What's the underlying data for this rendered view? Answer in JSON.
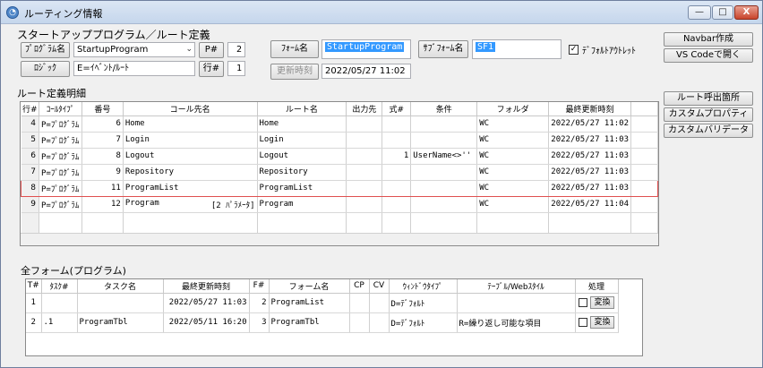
{
  "window": {
    "title": "ルーティング情報",
    "icon": "app-icon",
    "min_label": "—",
    "max_label": "□",
    "close_label": "X"
  },
  "startup": {
    "section_title": "スタートアッププログラム／ルート定義",
    "program_button": "ﾌﾟﾛｸﾞﾗﾑ名",
    "program_value": "StartupProgram",
    "p_label": "P#",
    "p_value": "2",
    "logic_button": "ﾛｼﾞｯｸ",
    "logic_value": "E=ｲﾍﾞﾝﾄ/ﾙｰﾄ",
    "row_label": "行#",
    "row_value": "1",
    "form_button": "ﾌｫｰﾑ名",
    "form_value": "StartupProgram",
    "subform_button": "ｻﾌﾞﾌｫｰﾑ名",
    "subform_value": "SF1",
    "default_outlet_label": "ﾃﾞﾌｫﾙﾄｱｳﾄﾚｯﾄ",
    "default_outlet_checked": "✓",
    "updated_button": "更新時刻",
    "updated_value": "2022/05/27 11:02"
  },
  "right_buttons": {
    "navbar": "Navbar作成",
    "vscode": "VS Codeで開く",
    "route_caller": "ルート呼出箇所",
    "custom_property": "カスタムプロパティ",
    "custom_validator": "カスタムバリデータ"
  },
  "routes": {
    "section_title": "ルート定義明細",
    "columns": [
      "行#",
      "ｺｰﾙﾀｲﾌﾟ",
      "番号",
      "コール先名",
      "ルート名",
      "出力先",
      "式#",
      "条件",
      "フォルダ",
      "最終更新時刻"
    ],
    "rows": [
      {
        "row": "4",
        "type": "P=ﾌﾟﾛｸﾞﾗﾑ",
        "num": "6",
        "callee": "Home",
        "callee_extra": "",
        "route": "Home",
        "output": "",
        "expr": "",
        "cond": "",
        "folder": "WC",
        "updated": "2022/05/27 11:02"
      },
      {
        "row": "5",
        "type": "P=ﾌﾟﾛｸﾞﾗﾑ",
        "num": "7",
        "callee": "Login",
        "callee_extra": "",
        "route": "Login",
        "output": "",
        "expr": "",
        "cond": "",
        "folder": "WC",
        "updated": "2022/05/27 11:03"
      },
      {
        "row": "6",
        "type": "P=ﾌﾟﾛｸﾞﾗﾑ",
        "num": "8",
        "callee": "Logout",
        "callee_extra": "",
        "route": "Logout",
        "output": "",
        "expr": "1",
        "cond": "UserName<>''",
        "folder": "WC",
        "updated": "2022/05/27 11:03"
      },
      {
        "row": "7",
        "type": "P=ﾌﾟﾛｸﾞﾗﾑ",
        "num": "9",
        "callee": "Repository",
        "callee_extra": "",
        "route": "Repository",
        "output": "",
        "expr": "",
        "cond": "",
        "folder": "WC",
        "updated": "2022/05/27 11:03"
      },
      {
        "row": "8",
        "type": "P=ﾌﾟﾛｸﾞﾗﾑ",
        "num": "11",
        "callee": "ProgramList",
        "callee_extra": "",
        "route": "ProgramList",
        "output": "",
        "expr": "",
        "cond": "",
        "folder": "WC",
        "updated": "2022/05/27 11:03"
      },
      {
        "row": "9",
        "type": "P=ﾌﾟﾛｸﾞﾗﾑ",
        "num": "12",
        "callee": "Program",
        "callee_extra": "[2 ﾊﾟﾗﾒｰﾀ]",
        "route": "Program",
        "output": "",
        "expr": "",
        "cond": "",
        "folder": "WC",
        "updated": "2022/05/27 11:04"
      }
    ],
    "selected_row": "8"
  },
  "forms": {
    "section_title": "全フォーム(プログラム)",
    "columns": [
      "T#",
      "ﾀｽｸ#",
      "タスク名",
      "最終更新時刻",
      "F#",
      "フォーム名",
      "CP",
      "CV",
      "ｳｨﾝﾄﾞｳﾀｲﾌﾟ",
      "ﾃｰﾌﾞﾙ/Webｽﾀｲﾙ",
      "処理"
    ],
    "rows": [
      {
        "t": "1",
        "task": "",
        "task_name": "",
        "updated": "2022/05/27 11:03",
        "f": "2",
        "form": "ProgramList",
        "cp": "",
        "cv": "",
        "window_type": "D=ﾃﾞﾌｫﾙﾄ",
        "style": "",
        "action": "変換"
      },
      {
        "t": "2",
        "task": ".1",
        "task_name": "ProgramTbl",
        "updated": "2022/05/11 16:20",
        "f": "3",
        "form": "ProgramTbl",
        "cp": "",
        "cv": "",
        "window_type": "D=ﾃﾞﾌｫﾙﾄ",
        "style": "R=繰り返し可能な項目",
        "action": "変換"
      }
    ]
  }
}
